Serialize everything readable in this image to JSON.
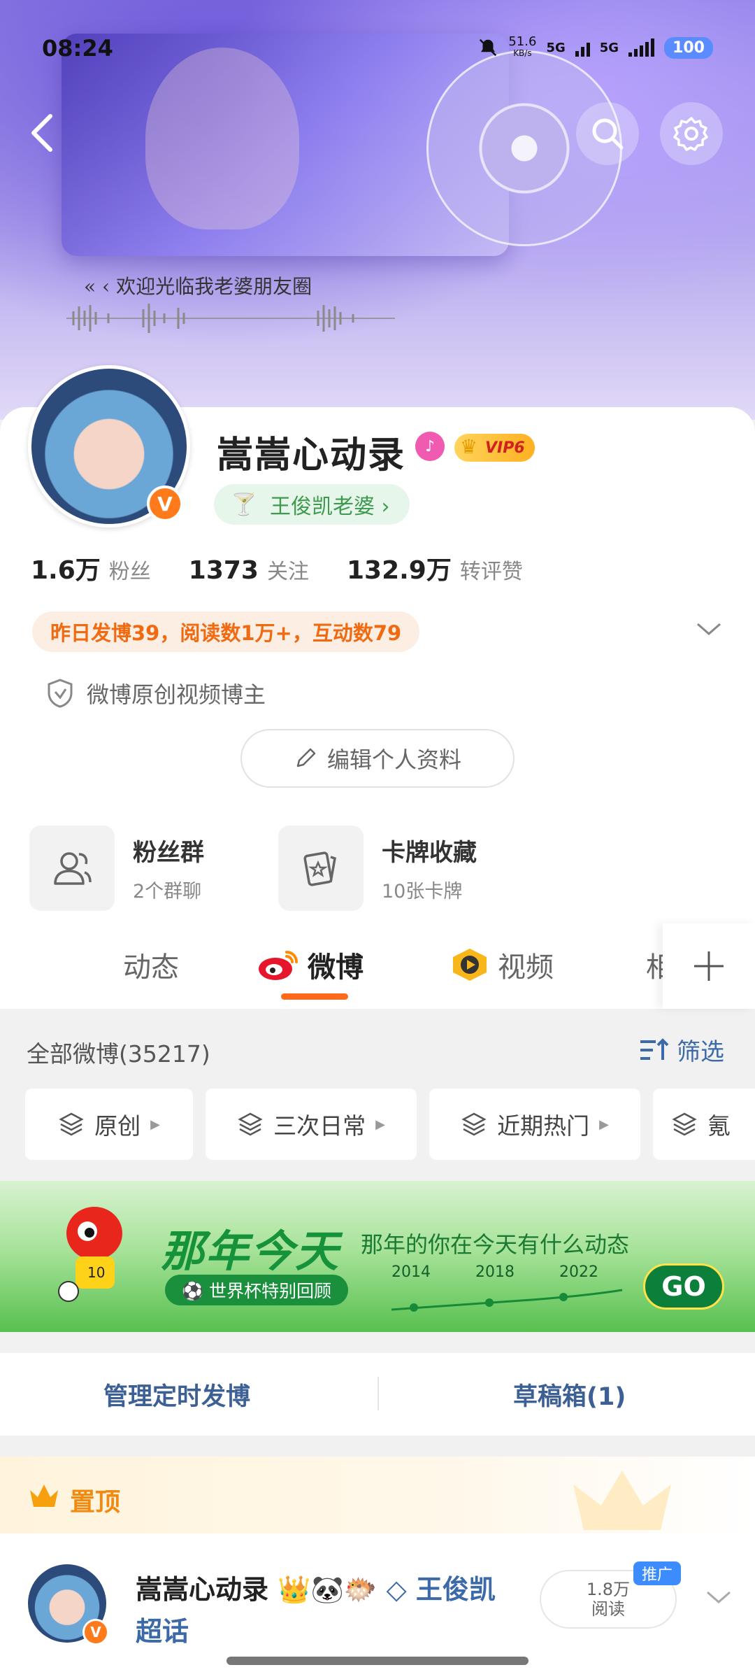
{
  "status": {
    "time": "08:24",
    "speed": "51.6",
    "speed_unit": "KB/s",
    "net1": "5G",
    "net2": "5G",
    "battery": "100"
  },
  "banner": {
    "song": "« ‹ 欢迎光临我老婆朋友圈"
  },
  "profile": {
    "nickname": "嵩嵩心动录",
    "vip": "VIP6",
    "fanclub": "王俊凯老婆 ›",
    "stats": [
      {
        "num": "1.6万",
        "label": "粉丝"
      },
      {
        "num": "1373",
        "label": "关注"
      },
      {
        "num": "132.9万",
        "label": "转评赞"
      }
    ],
    "daily": "昨日发博39，阅读数1万+，互动数79",
    "creator": "微博原创视频博主",
    "edit": "编辑个人资料"
  },
  "tiles": [
    {
      "title": "粉丝群",
      "sub": "2个群聊"
    },
    {
      "title": "卡牌收藏",
      "sub": "10张卡牌"
    }
  ],
  "tabs": [
    "动态",
    "微博",
    "视频",
    "相"
  ],
  "feed": {
    "all": "全部微博(35217)",
    "filter": "筛选",
    "chips": [
      "原创",
      "三次日常",
      "近期热门",
      "氪"
    ]
  },
  "ad": {
    "title": "那年今天",
    "subtitle": "那年的你在今天有什么动态",
    "pill": "⚽ 世界杯特别回顾",
    "years": [
      "2014",
      "2018",
      "2022"
    ],
    "go": "GO"
  },
  "schedule": {
    "left": "管理定时发博",
    "right": "草稿箱(1)"
  },
  "pinned": {
    "label": "置顶",
    "author": "嵩嵩心动录",
    "emojis": "👑🐼🐡",
    "topic": "王俊凯超话",
    "reads_num": "1.8万",
    "reads_label": "阅读",
    "promo": "推广"
  },
  "colors": {
    "accent": "#ff6a1a",
    "link": "#3c6aa8",
    "green": "#16923a"
  }
}
